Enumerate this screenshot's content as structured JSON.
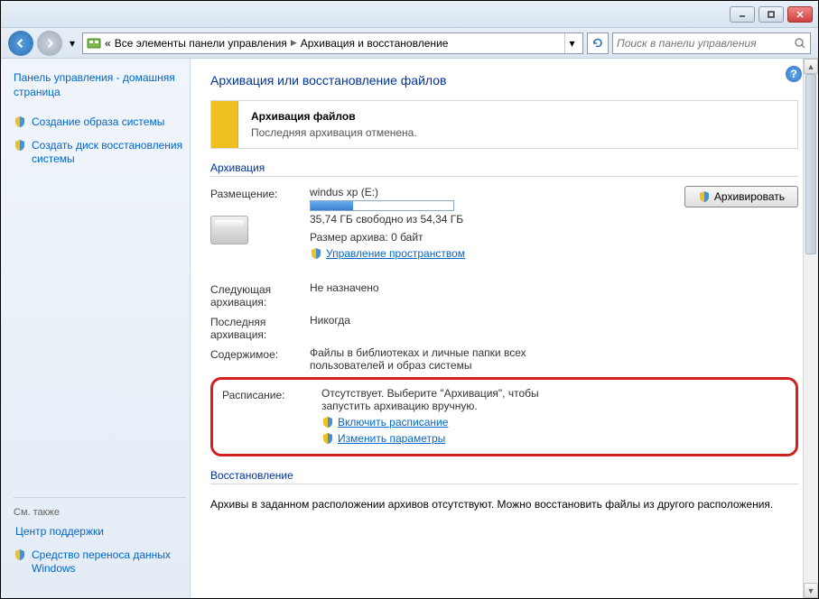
{
  "titlebar": {},
  "breadcrumb": {
    "item1": "Все элементы панели управления",
    "item2": "Архивация и восстановление"
  },
  "search": {
    "placeholder": "Поиск в панели управления"
  },
  "sidebar": {
    "home": "Панель управления - домашняя страница",
    "link1": "Создание образа системы",
    "link2": "Создать диск восстановления системы",
    "see_also": "См. также",
    "foot1": "Центр поддержки",
    "foot2": "Средство переноса данных Windows"
  },
  "page": {
    "title": "Архивация или восстановление файлов",
    "banner_title": "Архивация файлов",
    "banner_sub": "Последняя архивация отменена.",
    "sec_backup": "Архивация",
    "loc_label": "Размещение:",
    "loc_val": "windus xp (E:)",
    "free_text": "35,74 ГБ свободно из 54,34 ГБ",
    "size_text": "Размер архива: 0 байт",
    "manage_link": "Управление пространством",
    "backup_btn": "Архивировать",
    "next_label": "Следующая архивация:",
    "next_val": "Не назначено",
    "last_label": "Последняя архивация:",
    "last_val": "Никогда",
    "content_label": "Содержимое:",
    "content_val": "Файлы в библиотеках и личные папки всех пользователей и образ системы",
    "sched_label": "Расписание:",
    "sched_val": "Отсутствует. Выберите \"Архивация\", чтобы запустить архивацию вручную.",
    "enable_sched": "Включить расписание",
    "change_params": "Изменить параметры",
    "sec_restore": "Восстановление",
    "restore_text": "Архивы в заданном расположении архивов отсутствуют. Можно восстановить файлы из другого расположения."
  }
}
